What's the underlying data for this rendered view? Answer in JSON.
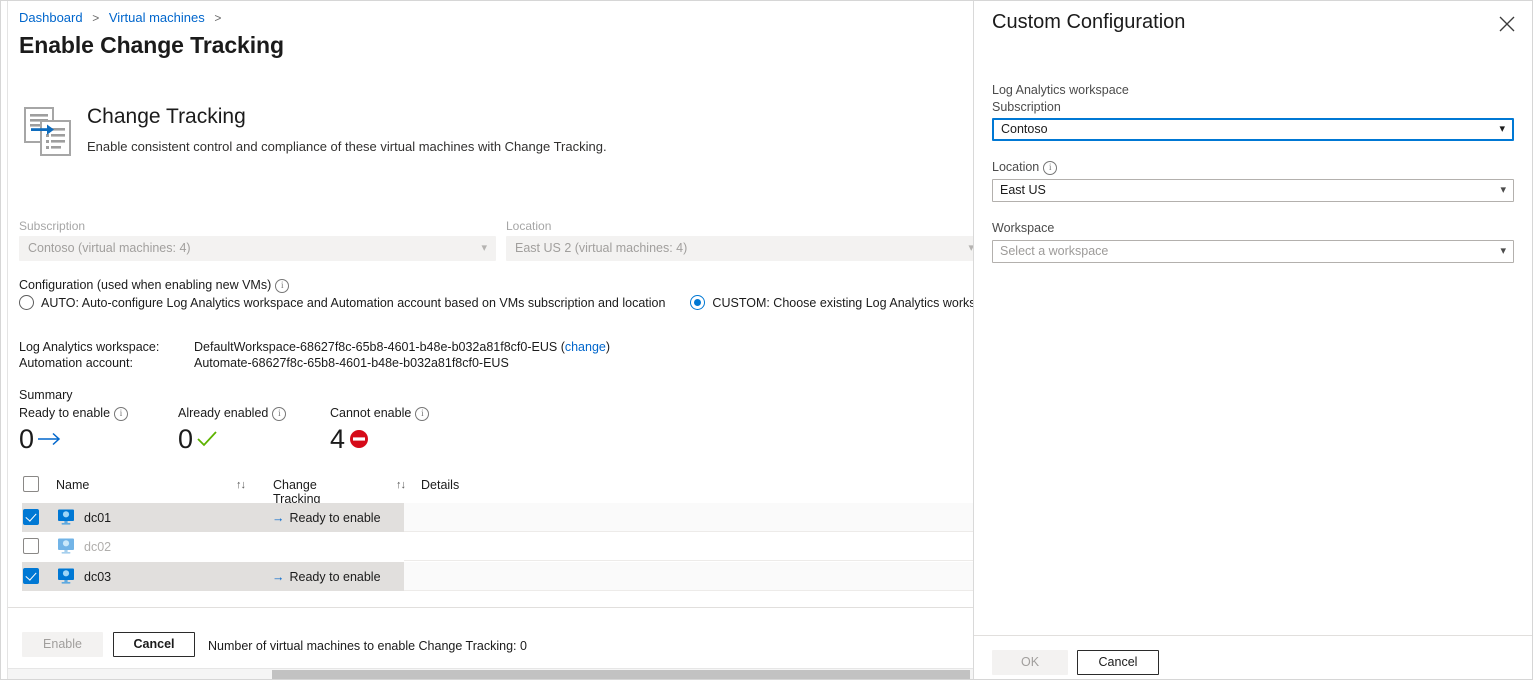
{
  "breadcrumb": {
    "items": [
      "Dashboard",
      "Virtual machines"
    ],
    "separator": ">"
  },
  "page": {
    "title": "Enable Change Tracking"
  },
  "hero": {
    "icon": "change-tracking-icon",
    "title": "Change Tracking",
    "description": "Enable consistent control and compliance of these virtual machines with Change Tracking."
  },
  "filters": {
    "subscription": {
      "label": "Subscription",
      "value": "Contoso (virtual machines: 4)",
      "disabled": true
    },
    "location": {
      "label": "Location",
      "value": "East US 2 (virtual machines: 4)",
      "disabled": true
    }
  },
  "configuration": {
    "label": "Configuration (used when enabling new VMs)",
    "info_icon": "info-icon",
    "options": [
      {
        "id": "auto",
        "label": "AUTO: Auto-configure Log Analytics workspace and Automation account based on VMs subscription and location",
        "selected": false
      },
      {
        "id": "custom",
        "label": "CUSTOM: Choose existing Log Analytics workspa",
        "selected": true
      }
    ]
  },
  "details": {
    "workspace_label": "Log Analytics workspace:",
    "workspace_value": "DefaultWorkspace-68627f8c-65b8-4601-b48e-b032a81f8cf0-EUS",
    "workspace_change_link": "change",
    "automation_label": "Automation account:",
    "automation_value": "Automate-68627f8c-65b8-4601-b48e-b032a81f8cf0-EUS"
  },
  "summary": {
    "heading": "Summary",
    "items": [
      {
        "label": "Ready to enable",
        "value": "0",
        "icon": "arrow-right-icon",
        "color": "#0066cc"
      },
      {
        "label": "Already enabled",
        "value": "0",
        "icon": "check-icon",
        "color": "#5db300"
      },
      {
        "label": "Cannot enable",
        "value": "4",
        "icon": "blocked-icon",
        "color": "#d13438"
      }
    ]
  },
  "table": {
    "columns": [
      "Name",
      "Change Tracking",
      "Details"
    ],
    "sort_icon": "sort-arrows-icon",
    "header_checkbox_checked": false,
    "rows": [
      {
        "name": "dc01",
        "checked": true,
        "status": "Ready to enable",
        "status_icon": "arrow-right-icon",
        "details": "",
        "highlighted": true,
        "disabled": false
      },
      {
        "name": "dc02",
        "checked": false,
        "status": "",
        "status_icon": "",
        "details": "",
        "highlighted": false,
        "disabled": true
      },
      {
        "name": "dc03",
        "checked": true,
        "status": "Ready to enable",
        "status_icon": "arrow-right-icon",
        "details": "",
        "highlighted": true,
        "disabled": false
      }
    ]
  },
  "actionbar": {
    "enable_label": "Enable",
    "enable_disabled": true,
    "cancel_label": "Cancel",
    "note": "Number of virtual machines to enable Change Tracking: 0"
  },
  "panel": {
    "title": "Custom Configuration",
    "close_icon": "close-icon",
    "section_label": "Log Analytics workspace",
    "fields": [
      {
        "id": "subscription",
        "label": "Subscription",
        "value": "Contoso",
        "placeholder": "",
        "focused": true,
        "info": false
      },
      {
        "id": "location",
        "label": "Location",
        "value": "East US",
        "placeholder": "",
        "focused": false,
        "info": true
      },
      {
        "id": "workspace",
        "label": "Workspace",
        "value": "",
        "placeholder": "Select a workspace",
        "focused": false,
        "info": false
      }
    ],
    "footer": {
      "ok_label": "OK",
      "ok_disabled": true,
      "cancel_label": "Cancel"
    }
  },
  "theme": {
    "accent": "#0078d4",
    "link": "#0066cc",
    "success": "#5db300",
    "danger": "#d13438"
  }
}
